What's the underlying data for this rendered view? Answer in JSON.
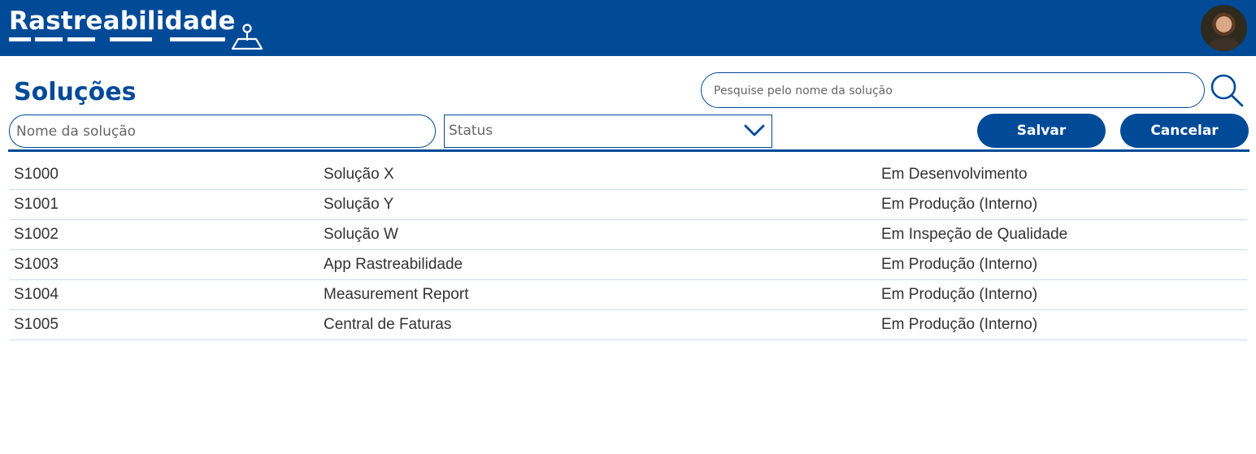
{
  "header": {
    "app_title": "Rastreabilidade",
    "brand_color": "#004a98",
    "map_icon": "map-pin-icon",
    "avatar_icon": "user-avatar"
  },
  "page": {
    "title": "Soluções"
  },
  "search": {
    "placeholder": "Pesquise pelo nome da solução",
    "value": "",
    "icon": "search-icon"
  },
  "form": {
    "name_placeholder": "Nome da solução",
    "name_value": "",
    "status_label": "Status",
    "status_icon": "chevron-down-icon",
    "save_label": "Salvar",
    "cancel_label": "Cancelar"
  },
  "table": {
    "rows": [
      {
        "id": "S1000",
        "name": "Solução X",
        "status": "Em Desenvolvimento"
      },
      {
        "id": "S1001",
        "name": "Solução Y",
        "status": "Em Produção (Interno)"
      },
      {
        "id": "S1002",
        "name": "Solução W",
        "status": "Em Inspeção de Qualidade"
      },
      {
        "id": "S1003",
        "name": "App Rastreabilidade",
        "status": "Em Produção (Interno)"
      },
      {
        "id": "S1004",
        "name": "Measurement Report",
        "status": "Em Produção (Interno)"
      },
      {
        "id": "S1005",
        "name": "Central de Faturas",
        "status": "Em Produção (Interno)"
      }
    ]
  }
}
